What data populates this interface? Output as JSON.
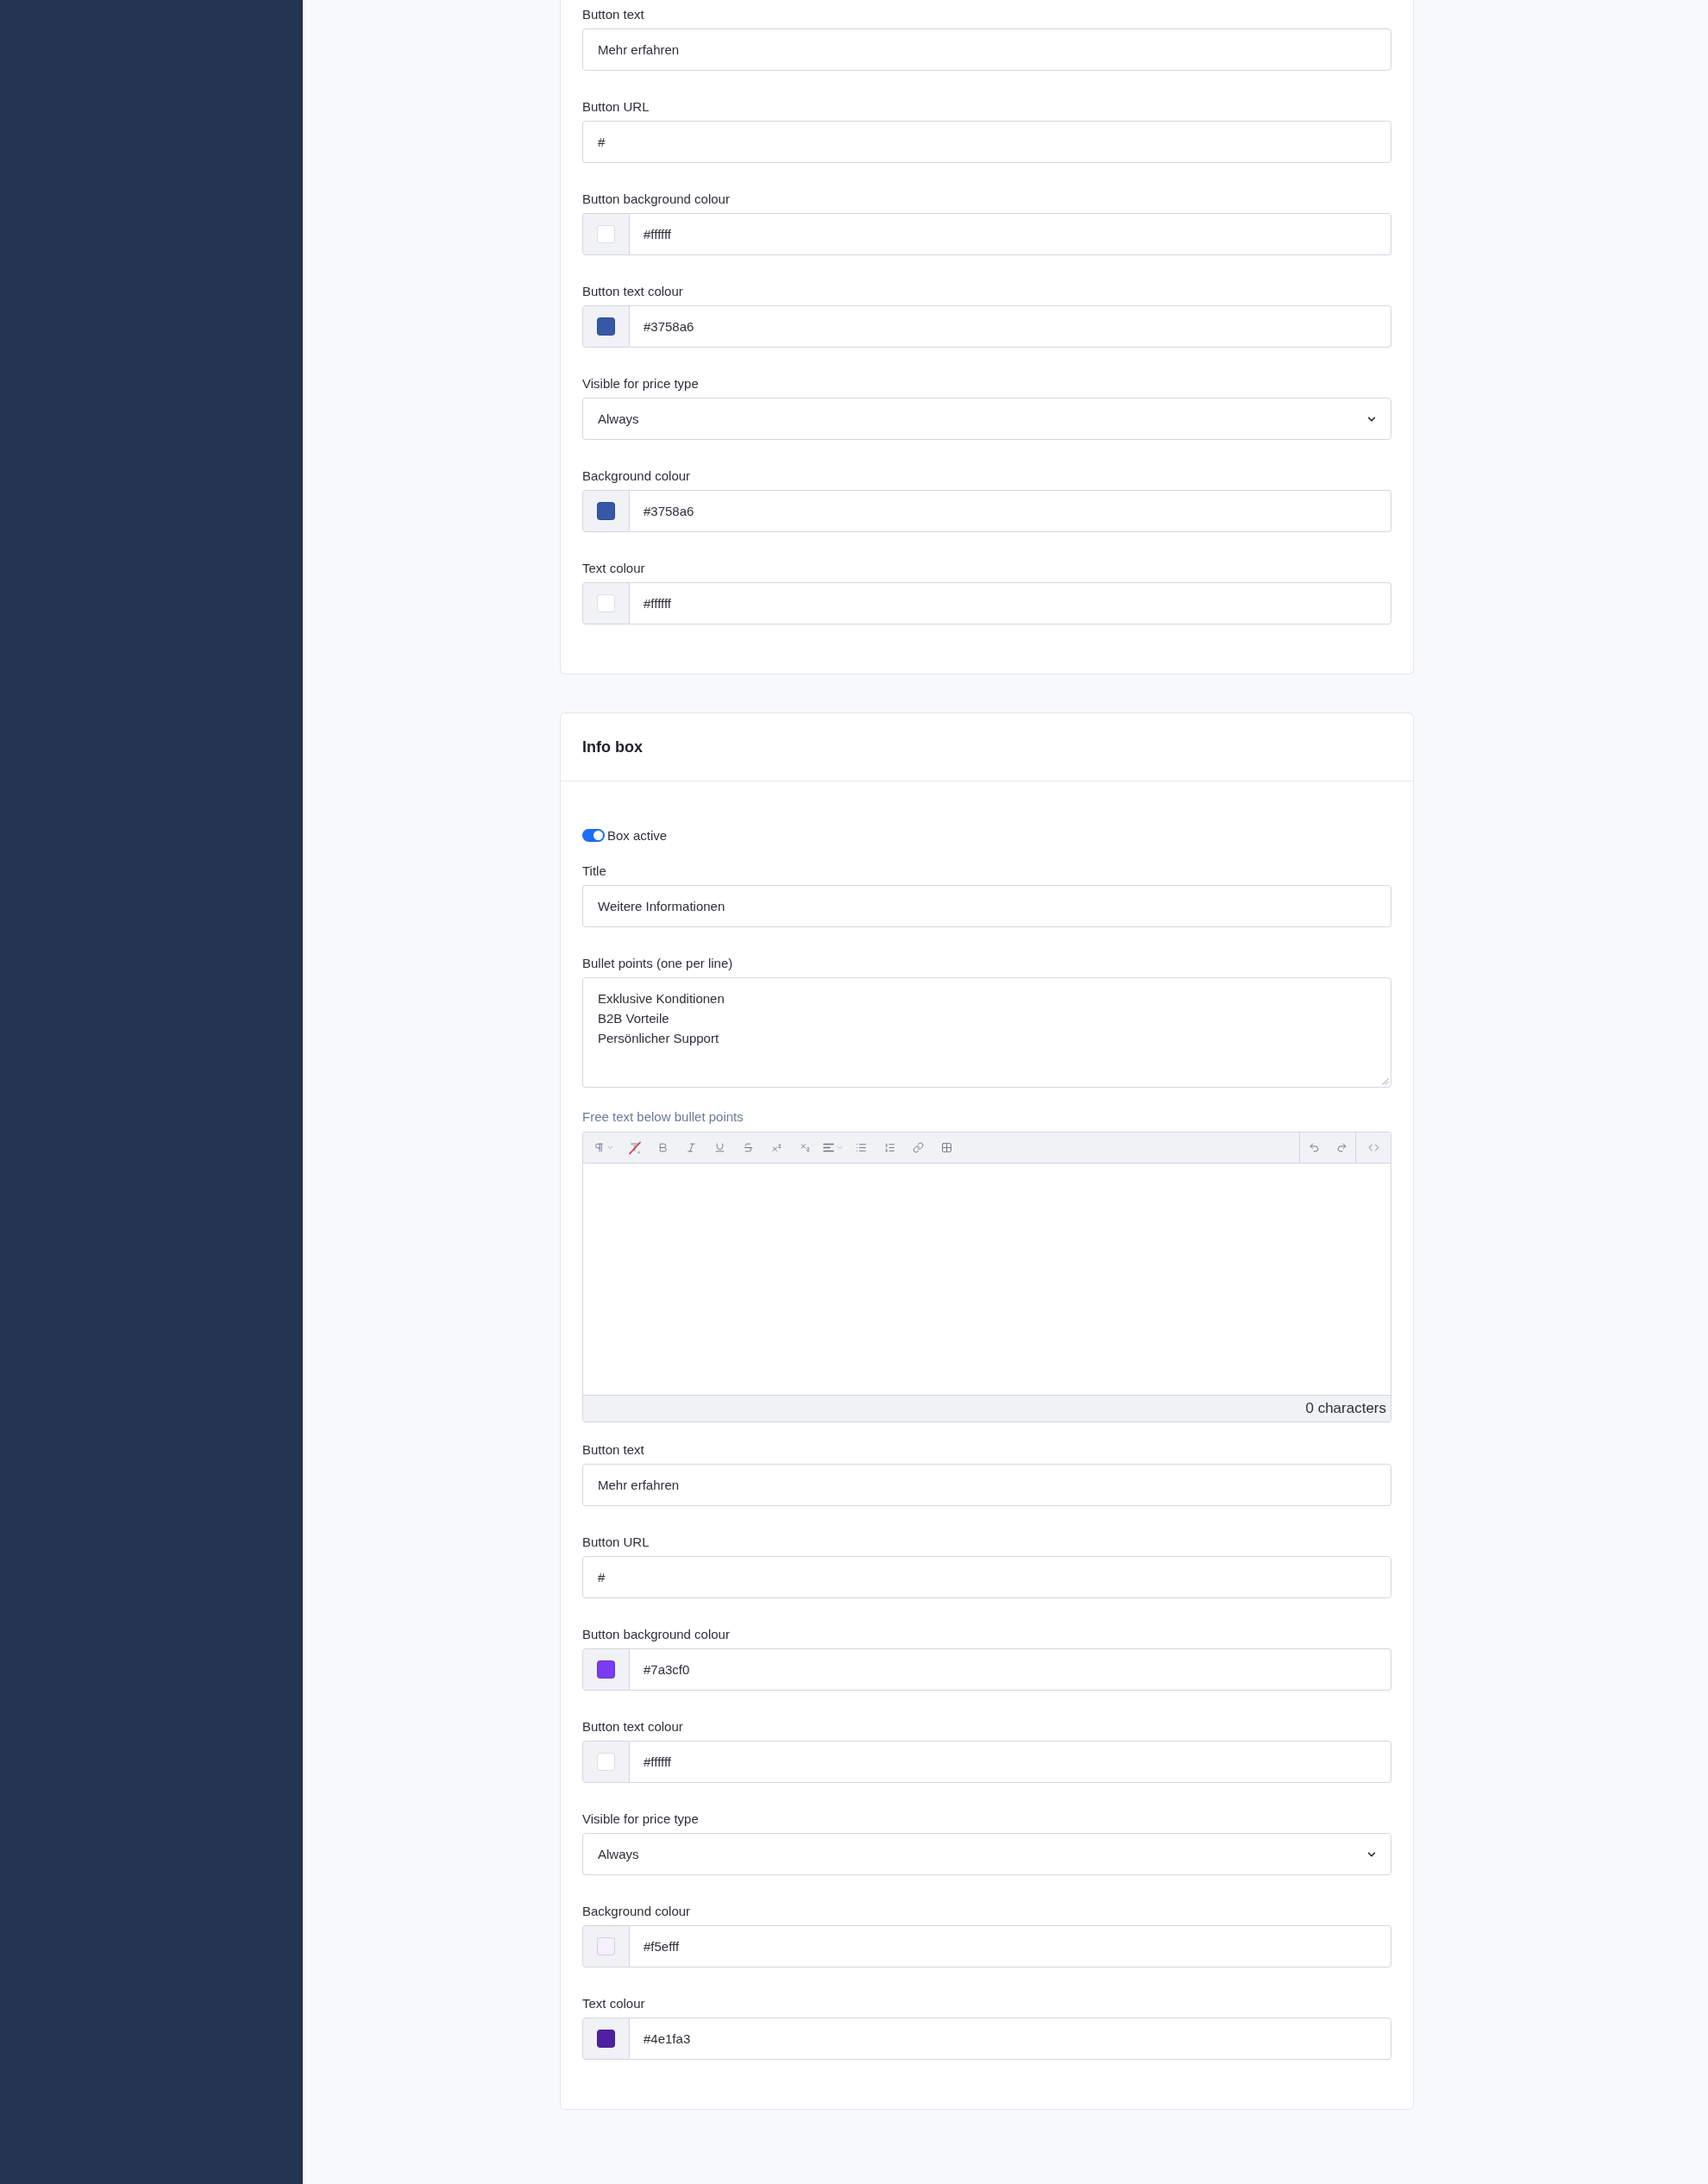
{
  "cards": [
    {
      "fields": [
        {
          "kind": "text",
          "label": "Button text",
          "value": "Mehr erfahren"
        },
        {
          "kind": "text",
          "label": "Button URL",
          "value": "#"
        },
        {
          "kind": "color",
          "label": "Button background colour",
          "value": "#ffffff",
          "color": "#ffffff"
        },
        {
          "kind": "color",
          "label": "Button text colour",
          "value": "#3758a6",
          "color": "#3758a6"
        },
        {
          "kind": "select",
          "label": "Visible for price type",
          "value": "Always"
        },
        {
          "kind": "color",
          "label": "Background colour",
          "value": "#3758a6",
          "color": "#3758a6"
        },
        {
          "kind": "color",
          "label": "Text colour",
          "value": "#ffffff",
          "color": "#ffffff"
        }
      ]
    },
    {
      "title": "Info box",
      "fields": [
        {
          "kind": "toggle",
          "label": "Box active",
          "on": true
        },
        {
          "kind": "text",
          "label": "Title",
          "value": "Weitere Informationen"
        },
        {
          "kind": "textarea",
          "label": "Bullet points (one per line)",
          "value": "Exklusive Konditionen\nB2B Vorteile\nPersönlicher Support"
        },
        {
          "kind": "editor",
          "label": "Free text below bullet points",
          "counter": "0 characters"
        },
        {
          "kind": "text",
          "label": "Button text",
          "value": "Mehr erfahren"
        },
        {
          "kind": "text",
          "label": "Button URL",
          "value": "#"
        },
        {
          "kind": "color",
          "label": "Button background colour",
          "value": "#7a3cf0",
          "color": "#7a3cf0"
        },
        {
          "kind": "color",
          "label": "Button text colour",
          "value": "#ffffff",
          "color": "#ffffff"
        },
        {
          "kind": "select",
          "label": "Visible for price type",
          "value": "Always"
        },
        {
          "kind": "color",
          "label": "Background colour",
          "value": "#f5efff",
          "color": "#f5efff"
        },
        {
          "kind": "color",
          "label": "Text colour",
          "value": "#4e1fa3",
          "color": "#4e1fa3"
        }
      ]
    }
  ]
}
